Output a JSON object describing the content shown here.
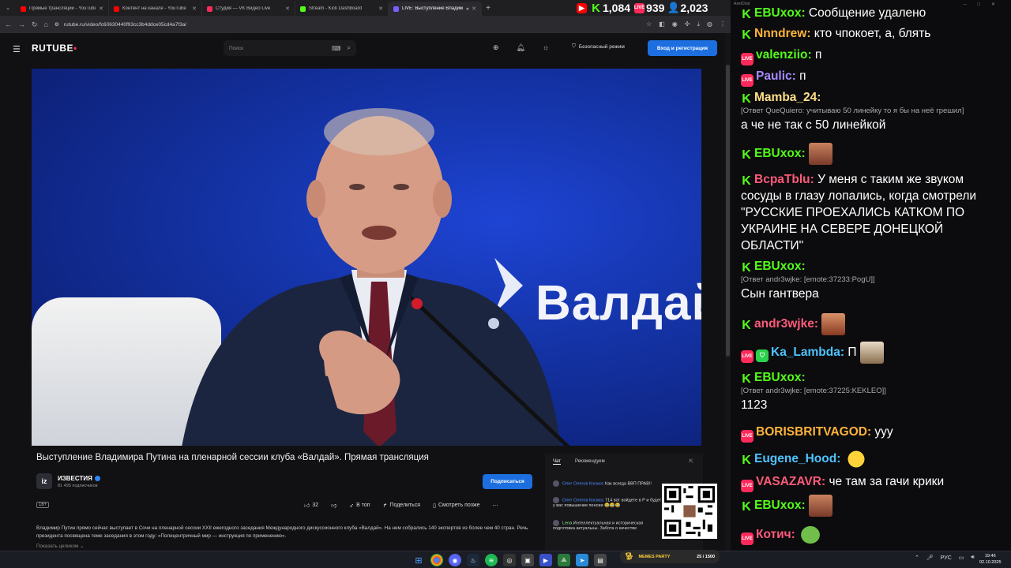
{
  "browser": {
    "tabs": [
      {
        "title": "Прямые трансляции - YouTube",
        "color": "#ff0000"
      },
      {
        "title": "Контент на канале - YouTube",
        "color": "#ff0000"
      },
      {
        "title": "Студия — VK Видео Live",
        "color": "#ff2a5b"
      },
      {
        "title": "Stream - Kick Dashboard",
        "color": "#53fc18"
      },
      {
        "title": "LIVE: Выступление Владим",
        "color": "#7b5cff"
      }
    ],
    "stats": [
      {
        "icon": "youtube-icon",
        "value": "",
        "color": "#ff0000"
      },
      {
        "icon": "kick-icon",
        "value": "1,084",
        "color": "#53fc18"
      },
      {
        "icon": "live-icon",
        "value": "939",
        "color": "#ff2a5b"
      },
      {
        "icon": "user-icon",
        "value": "2,023",
        "color": "#4aa3ff"
      }
    ],
    "url": "rutube.ru/video/fc60630440f93cc3b4ddce05cd4a7f3a/"
  },
  "rutube": {
    "logo": "RUTUBE",
    "search_placeholder": "Поиск",
    "safe_mode": "Безопасный режим",
    "login": "Вход и регистрация",
    "video_title": "Выступление Владимира Путина на пленарной сессии клуба «Валдай». Прямая трансляция",
    "video_overlay_text": "Валдай",
    "channel": {
      "name": "ИЗВЕСТИЯ",
      "avatar": "iz",
      "subs": "81 495 подписчиков"
    },
    "subscribe": "Подписаться",
    "age": "16+",
    "actions": {
      "likes": "32",
      "top": "В топ",
      "share": "Поделиться",
      "watch_later": "Смотреть позже"
    },
    "description": "Владимир Путин прямо сейчас выступает в Сочи на пленарной сессии XXII ежегодного заседания Международного дискуссионного клуба «Валдай». На нем собрались 140 экспертов из более чем 40 стран. Речь президента посвящена теме заседания в этом году: «Полицентричный мир — инструкция по применению».",
    "show_all": "Показать целиком",
    "side_tabs": [
      "Чат",
      "Рекомендуем"
    ],
    "side_messages": [
      {
        "name": "Олег Олегов Космос",
        "text": "Как всегда ВВП ПРАВ!!"
      },
      {
        "name": "Олег Олегов Космос",
        "text": "714 вот войдете в Р и будет у вас повышение пенсии 😂😂😂"
      },
      {
        "name": "Lena",
        "text": "Интеллектуальная и историческая подготовка актуальны. Забота о качестве"
      }
    ]
  },
  "chat": {
    "title": "AxelChat",
    "messages": [
      {
        "badge": "kick",
        "nick": "EBUxox",
        "color": "#53fc18",
        "text": "Сообщение удалено",
        "reply": ""
      },
      {
        "badge": "kick",
        "nick": "Nnndrew",
        "color": "#ffb43a",
        "text": "кто чпокоет, а, блять",
        "reply": ""
      },
      {
        "badge": "live",
        "nick": "valenziio",
        "color": "#53fc18",
        "text": "п",
        "reply": ""
      },
      {
        "badge": "live",
        "nick": "Paulic",
        "color": "#a58cff",
        "text": "п",
        "reply": ""
      },
      {
        "badge": "kick",
        "nick": "Mamba_24",
        "color": "#ffe08a",
        "text": "а че не так с 50 линейкой",
        "reply": "[Ответ QueQuiero: учитываю 50 линейку то я бы на неё грешил]"
      },
      {
        "badge": "kick",
        "nick": "EBUxox",
        "color": "#53fc18",
        "text": "",
        "reply": ""
      },
      {
        "badge": "kick",
        "nick": "BcpaTblu",
        "color": "#ff5a7a",
        "text": "У меня с таким же звуком сосуды в глазу лопались, когда смотрели \"РУССКИЕ ПРОЕХАЛИСЬ КАТКОМ ПО УКРАИНЕ НА СЕВЕРЕ ДОНЕЦКОЙ ОБЛАСТИ\"",
        "reply": ""
      },
      {
        "badge": "kick",
        "nick": "EBUxox",
        "color": "#53fc18",
        "text": "Сын гантвера",
        "reply": "[Ответ andr3wjke: [emote:37233:PogU]]"
      },
      {
        "badge": "kick",
        "nick": "andr3wjke",
        "color": "#ff5a7a",
        "text": "",
        "reply": ""
      },
      {
        "badge": "live",
        "nick": "Ka_Lambda",
        "color": "#4fc3ff",
        "text": "П",
        "reply": ""
      },
      {
        "badge": "kick",
        "nick": "EBUxox",
        "color": "#53fc18",
        "text": "1123",
        "reply": "[Ответ andr3wjke: [emote:37225:KEKLEO]]"
      },
      {
        "badge": "live",
        "nick": "BORISBRITVAGOD",
        "color": "#ffb43a",
        "text": "ууу",
        "reply": ""
      },
      {
        "badge": "kick",
        "nick": "Eugene_Hood",
        "color": "#4fc3ff",
        "text": "",
        "reply": ""
      },
      {
        "badge": "live",
        "nick": "VASAZAVR",
        "color": "#ff5a7a",
        "text": "че там за гачи крики",
        "reply": ""
      },
      {
        "badge": "kick",
        "nick": "EBUxox",
        "color": "#53fc18",
        "text": "",
        "reply": ""
      },
      {
        "badge": "live",
        "nick": "Котич",
        "color": "#ff5a7a",
        "text": "",
        "reply": ""
      }
    ]
  },
  "taskbar": {
    "memes_label": "MEMES PARTY",
    "memes_count": "25 / 1500",
    "lang": "РУС",
    "time": "19:46",
    "date": "02.10.2025"
  }
}
